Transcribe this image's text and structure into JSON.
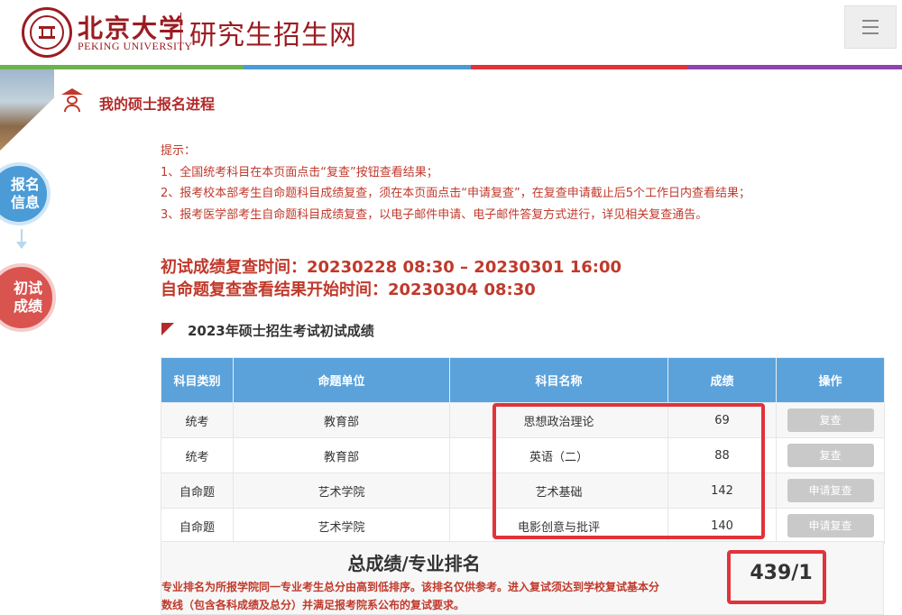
{
  "header": {
    "logo_cn": "北京大学",
    "logo_en": "PEKING UNIVERSITY",
    "site_title": "研究生招生网"
  },
  "colors": {
    "brand_red": "#9b1c22",
    "table_header_blue": "#5ba2db",
    "alert_red": "#c0392b",
    "highlight_red": "#e2323a",
    "bar_segments": [
      "#6bb34a",
      "#4a9bd6",
      "#e2323a",
      "#8e44ad"
    ]
  },
  "sidebar": {
    "steps": [
      {
        "label": "报名信息"
      },
      {
        "label": "初试成绩"
      }
    ]
  },
  "section": {
    "title": "我的硕士报名进程",
    "icon": "graduate-icon"
  },
  "notice": {
    "heading": "提示：",
    "lines": [
      "1、全国统考科目在本页面点击“复查”按钮查看结果；",
      "2、报考校本部考生自命题科目成绩复查，须在本页面点击“申请复查”，在复查申请截止后5个工作日内查看结果；",
      "3、报考医学部考生自命题科目成绩复查，以电子邮件申请、电子邮件答复方式进行，详见相关复查通告。"
    ]
  },
  "review_time": {
    "line1": "初试成绩复查时间：20230228 08:30 – 20230301 16:00",
    "line2": "自命题复查查看结果开始时间：20230304 08:30"
  },
  "exam": {
    "title": "2023年硕士招生考试初试成绩"
  },
  "table": {
    "headers": [
      "科目类别",
      "命题单位",
      "科目名称",
      "成绩",
      "操作"
    ],
    "rows": [
      {
        "category": "统考",
        "unit": "教育部",
        "subject": "思想政治理论",
        "score": "69",
        "action": "复查"
      },
      {
        "category": "统考",
        "unit": "教育部",
        "subject": "英语（二）",
        "score": "88",
        "action": "复查"
      },
      {
        "category": "自命题",
        "unit": "艺术学院",
        "subject": "艺术基础",
        "score": "142",
        "action": "申请复查"
      },
      {
        "category": "自命题",
        "unit": "艺术学院",
        "subject": "电影创意与批评",
        "score": "140",
        "action": "申请复查"
      }
    ],
    "total_label": "总成绩/专业排名",
    "total_note": "专业排名为所报学院同一专业考生总分由高到低排序。该排名仅供参考。进入复试须达到学校复试基本分数线（包含各科成绩及总分）并满足报考院系公布的复试要求。",
    "total_value": "439/1"
  }
}
